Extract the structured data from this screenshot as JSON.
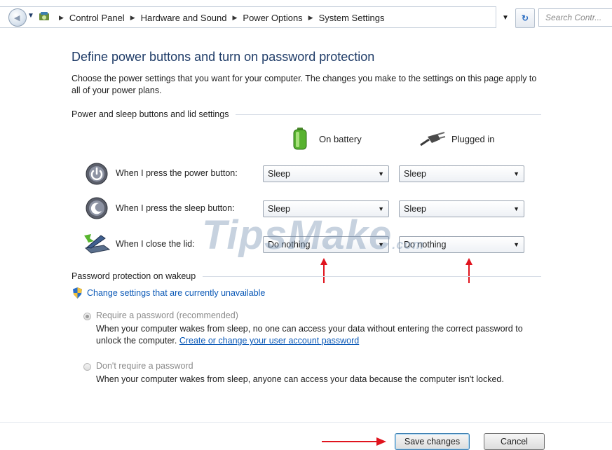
{
  "address_bar": {
    "breadcrumbs": [
      "Control Panel",
      "Hardware and Sound",
      "Power Options",
      "System Settings"
    ],
    "search_placeholder": "Search Contr..."
  },
  "page": {
    "title": "Define power buttons and turn on password protection",
    "description": "Choose the power settings that you want for your computer. The changes you make to the settings on this page apply to all of your power plans."
  },
  "buttons_section": {
    "heading": "Power and sleep buttons and lid settings",
    "columns": {
      "on_battery": "On battery",
      "plugged_in": "Plugged in"
    },
    "rows": [
      {
        "label": "When I press the power button:",
        "on_battery": "Sleep",
        "plugged_in": "Sleep",
        "icon": "power-button-icon"
      },
      {
        "label": "When I press the sleep button:",
        "on_battery": "Sleep",
        "plugged_in": "Sleep",
        "icon": "sleep-button-icon"
      },
      {
        "label": "When I close the lid:",
        "on_battery": "Do nothing",
        "plugged_in": "Do nothing",
        "icon": "laptop-lid-icon"
      }
    ]
  },
  "password_section": {
    "heading": "Password protection on wakeup",
    "change_link": "Change settings that are currently unavailable",
    "options": [
      {
        "label": "Require a password (recommended)",
        "selected": true,
        "description": "When your computer wakes from sleep, no one can access your data without entering the correct password to unlock the computer.",
        "link": "Create or change your user account password"
      },
      {
        "label": "Don't require a password",
        "selected": false,
        "description": "When your computer wakes from sleep, anyone can access your data because the computer isn't locked."
      }
    ]
  },
  "footer": {
    "save": "Save changes",
    "cancel": "Cancel"
  },
  "watermark": {
    "text": "TipsMake",
    "suffix": ".com"
  },
  "colors": {
    "title_blue": "#1e3b67",
    "link_blue": "#0b59b7",
    "annotation_red": "#e0141e"
  }
}
